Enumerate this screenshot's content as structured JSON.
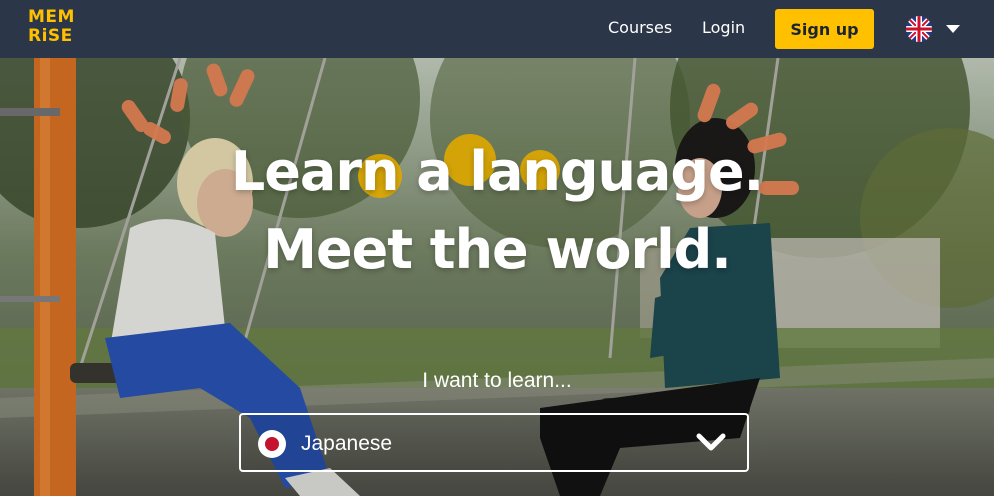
{
  "header": {
    "logo": {
      "line1": "MEM",
      "line2": "RiSE"
    },
    "nav": {
      "courses": "Courses",
      "login": "Login"
    },
    "signup_label": "Sign up",
    "language_flag_icon": "uk-flag-icon"
  },
  "hero": {
    "headline_line1": "Learn a language.",
    "headline_line2": "Meet the world.",
    "prompt": "I want to learn...",
    "language_select": {
      "selected": "Japanese",
      "flag_icon": "japan-flag-icon"
    }
  },
  "colors": {
    "header_bg": "#2b3648",
    "brand_yellow": "#ffc000",
    "accent_orange": "#f28a5b"
  }
}
